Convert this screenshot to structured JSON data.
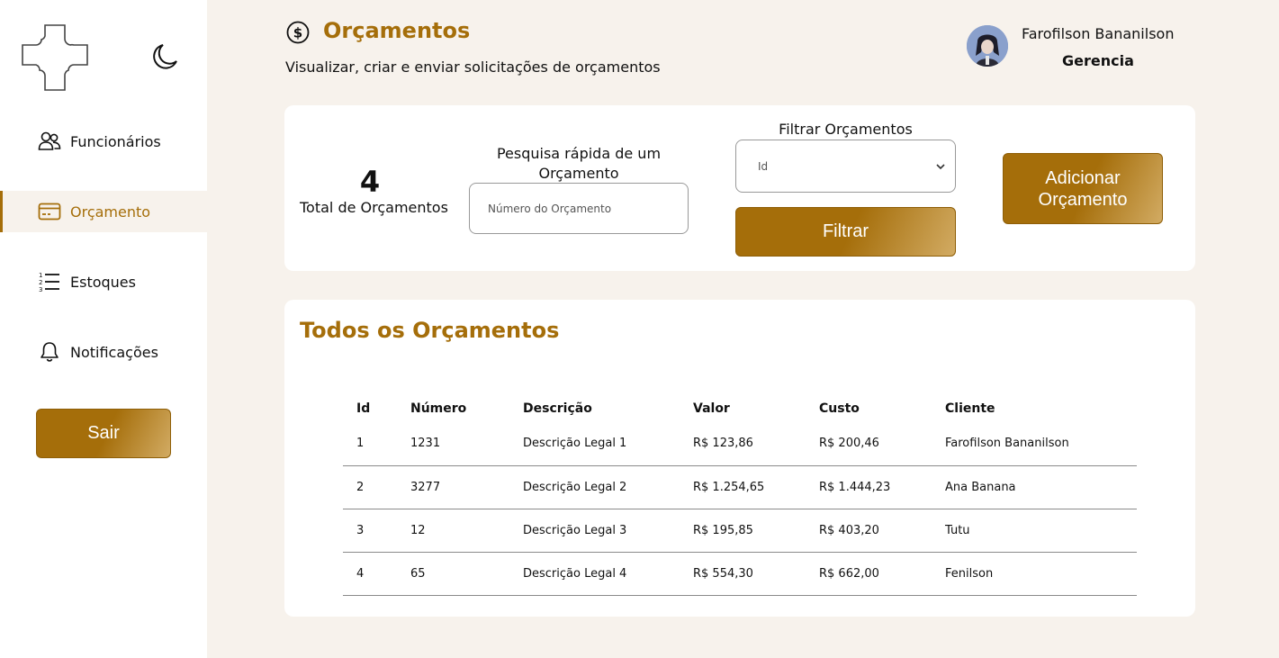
{
  "sidebar": {
    "items": [
      {
        "label": "Funcionários",
        "icon": "users-icon"
      },
      {
        "label": "Orçamento",
        "icon": "credit-card-icon"
      },
      {
        "label": "Estoques",
        "icon": "ordered-list-icon"
      },
      {
        "label": "Notificações",
        "icon": "bell-icon"
      }
    ],
    "logout_label": "Sair"
  },
  "header": {
    "title": "Orçamentos",
    "subtitle": "Visualizar, criar e enviar solicitações de orçamentos",
    "user_name": "Farofilson Bananilson",
    "user_role": "Gerencia"
  },
  "filters": {
    "total_count": "4",
    "total_label": "Total de Orçamentos",
    "search_label": "Pesquisa rápida de um Orçamento",
    "search_placeholder": "Número do Orçamento",
    "filter_label": "Filtrar Orçamentos",
    "filter_selected": "Id",
    "filter_button": "Filtrar",
    "add_button": "Adicionar Orçamento"
  },
  "table": {
    "title": "Todos os Orçamentos",
    "columns": [
      "Id",
      "Número",
      "Descrição",
      "Valor",
      "Custo",
      "Cliente"
    ],
    "rows": [
      [
        "1",
        "1231",
        "Descrição Legal 1",
        "R$ 123,86",
        "R$ 200,46",
        "Farofilson Bananilson"
      ],
      [
        "2",
        "3277",
        "Descrição Legal 2",
        "R$ 1.254,65",
        "R$ 1.444,23",
        "Ana Banana"
      ],
      [
        "3",
        "12",
        "Descrição Legal 3",
        "R$ 195,85",
        "R$ 403,20",
        "Tutu"
      ],
      [
        "4",
        "65",
        "Descrição Legal 4",
        "R$ 554,30",
        "R$ 662,00",
        "Fenilson"
      ]
    ]
  },
  "colors": {
    "accent": "#a56e0a",
    "background": "#f7f2ec",
    "card": "#ffffff"
  }
}
